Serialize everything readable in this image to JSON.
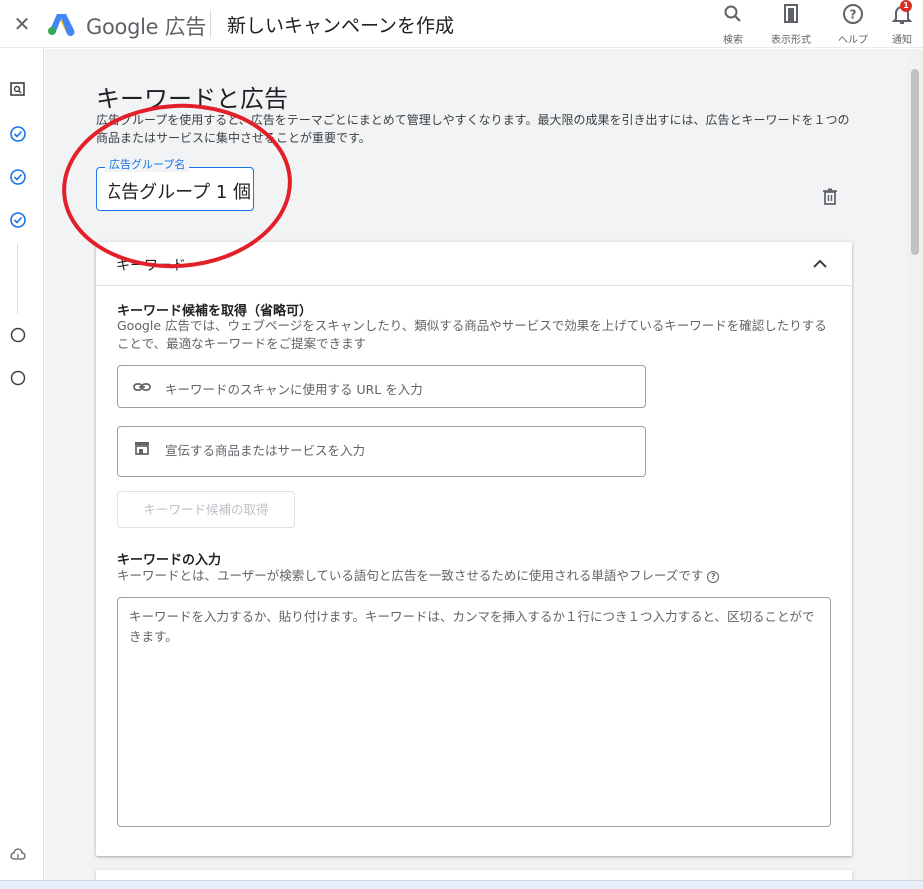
{
  "header": {
    "brand_google": "Google",
    "brand_product": "広告",
    "page_title": "新しいキャンペーンを作成",
    "actions": [
      {
        "label": "検索",
        "icon": "search-icon"
      },
      {
        "label": "表示形式",
        "icon": "appearance-icon"
      },
      {
        "label": "ヘルプ",
        "icon": "help-icon"
      },
      {
        "label": "通知",
        "icon": "bell-icon",
        "badge": "1"
      }
    ]
  },
  "leftrail": {
    "steps": [
      {
        "state": "current",
        "icon": "preview-icon"
      },
      {
        "state": "done",
        "icon": "check-circle-icon"
      },
      {
        "state": "done",
        "icon": "check-circle-icon"
      },
      {
        "state": "done",
        "icon": "check-circle-icon"
      },
      {
        "state": "todo",
        "icon": "empty-circle-icon"
      },
      {
        "state": "todo",
        "icon": "empty-circle-icon"
      }
    ]
  },
  "section": {
    "title": "キーワードと広告",
    "description": "広告グループを使用すると、広告をテーマごとにまとめて管理しやすくなります。最大限の成果を引き出すには、広告とキーワードを１つの商品またはサービスに集中させることが重要です。"
  },
  "ad_group": {
    "label": "広告グループ名",
    "value": "広告グループ 1 個"
  },
  "keywords_card": {
    "title": "キーワード",
    "suggest_title": "キーワード候補を取得（省略可）",
    "suggest_desc": "Google 広告では、ウェブページをスキャンしたり、類似する商品やサービスで効果を上げているキーワードを確認したりすることで、最適なキーワードをご提案できます",
    "url_placeholder": "キーワードのスキャンに使用する URL を入力",
    "product_placeholder": "宣伝する商品またはサービスを入力",
    "get_button": "キーワード候補の取得",
    "enter_title": "キーワードの入力",
    "enter_desc": "キーワードとは、ユーザーが検索している語句と広告を一致させるために使用される単語やフレーズです",
    "textarea_placeholder": "キーワードを入力するか、貼り付けます。キーワードは、カンマを挿入するか１行につき１つ入力すると、区切ることができます。"
  },
  "colors": {
    "accent": "#1a73e8",
    "annotation": "#e3202a",
    "background": "#f1f3f4"
  }
}
